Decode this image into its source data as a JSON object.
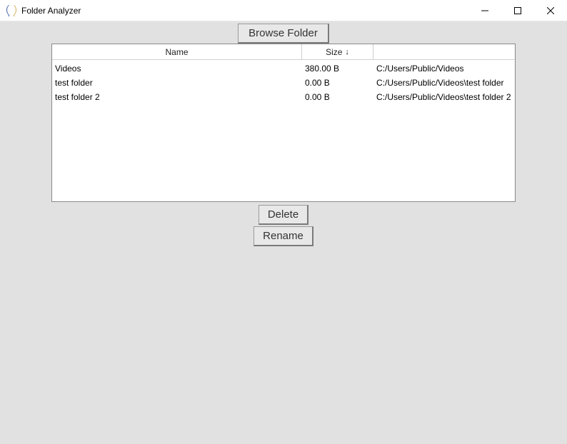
{
  "window": {
    "title": "Folder Analyzer"
  },
  "buttons": {
    "browse": "Browse Folder",
    "delete": "Delete",
    "rename": "Rename"
  },
  "table": {
    "headers": {
      "name": "Name",
      "size": "Size",
      "sort_indicator": "↓",
      "path": ""
    },
    "rows": [
      {
        "name": "Videos",
        "size": "380.00 B",
        "path": "C:/Users/Public/Videos"
      },
      {
        "name": "test folder",
        "size": "0.00 B",
        "path": "C:/Users/Public/Videos\\test folder"
      },
      {
        "name": "test folder 2",
        "size": "0.00 B",
        "path": "C:/Users/Public/Videos\\test folder 2"
      }
    ]
  }
}
